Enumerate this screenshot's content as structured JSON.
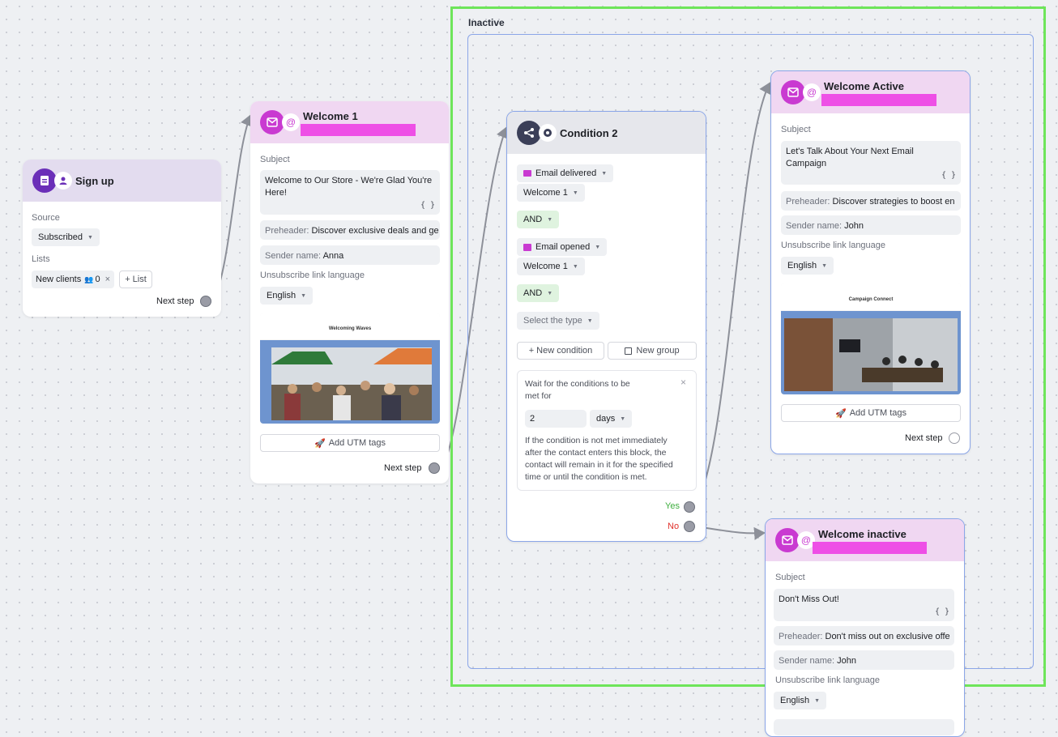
{
  "colors": {
    "highlight": "#6ee55a",
    "group_border": "#8ba6e8",
    "email_accent": "#c93ad1",
    "signup_accent": "#6b2fb8",
    "condition_accent": "#3b3f58",
    "redaction": "#ee4fe6"
  },
  "group": {
    "title": "Inactive"
  },
  "signup": {
    "title": "Sign up",
    "icons": [
      "signup-form-icon",
      "person-icon"
    ],
    "source_label": "Source",
    "source_value": "Subscribed",
    "lists_label": "Lists",
    "list_chip": "New clients",
    "list_chip_count": "0",
    "add_list_label": "+ List",
    "next_step": "Next step"
  },
  "welcome1": {
    "title": "Welcome 1",
    "subject_label": "Subject",
    "subject": "Welcome to Our Store - We're Glad You're Here!",
    "braces": "{ }",
    "preheader_key": "Preheader:",
    "preheader_value": "Discover exclusive deals and ge",
    "sender_key": "Sender name:",
    "sender_value": "Anna",
    "unsub_label": "Unsubscribe link language",
    "language": "English",
    "preview_title": "Welcoming Waves",
    "utm_label": "Add UTM tags",
    "next_step": "Next step"
  },
  "condition": {
    "title": "Condition 2",
    "cond1_event": "Email delivered",
    "cond1_email": "Welcome 1",
    "and1": "AND",
    "cond2_event": "Email opened",
    "cond2_email": "Welcome 1",
    "and2": "AND",
    "select_type": "Select the type",
    "new_condition": "+ New condition",
    "new_group": "New group",
    "wait_line1": "Wait for the conditions to be",
    "wait_line2": "met for",
    "close": "×",
    "wait_value": "2",
    "wait_unit": "days",
    "note1": "If the condition is not met immediately",
    "note2": "after the contact enters this block, the",
    "note3": "contact will remain in it for the specified",
    "note4": "time or until the condition is met.",
    "yes": "Yes",
    "no": "No",
    "yes_color": "#3fae3f",
    "no_color": "#e0302a"
  },
  "welcome_active": {
    "title": "Welcome Active",
    "subject_label": "Subject",
    "subject": "Let's Talk About Your Next Email Campaign",
    "braces": "{ }",
    "preheader_key": "Preheader:",
    "preheader_value": "Discover strategies to boost en",
    "sender_key": "Sender name:",
    "sender_value": "John",
    "unsub_label": "Unsubscribe link language",
    "language": "English",
    "preview_title": "Campaign Connect",
    "utm_label": "Add UTM tags",
    "next_step": "Next step"
  },
  "welcome_inactive": {
    "title": "Welcome inactive",
    "subject_label": "Subject",
    "subject": "Don't Miss Out!",
    "braces": "{ }",
    "preheader_key": "Preheader:",
    "preheader_value": "Don't miss out on exclusive offe",
    "sender_key": "Sender name:",
    "sender_value": "John",
    "unsub_label": "Unsubscribe link language",
    "language": "English"
  }
}
